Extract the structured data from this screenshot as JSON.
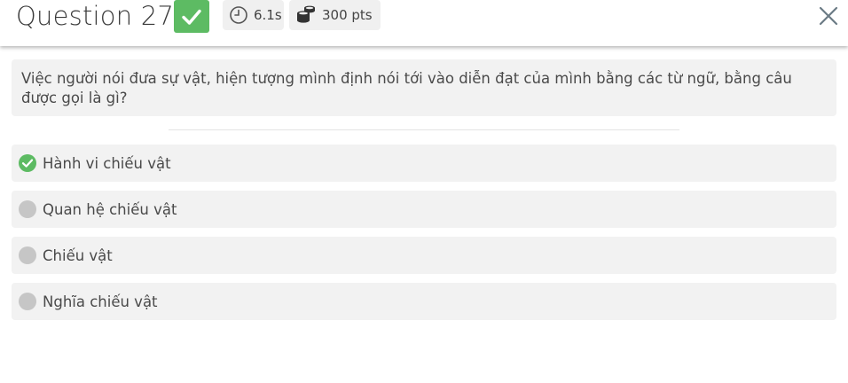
{
  "header": {
    "title": "Question 27",
    "status_icon": "check-icon",
    "time": "6.1s",
    "points": "300 pts",
    "close_icon": "close-icon"
  },
  "question": {
    "text": "Việc người nói đưa sự vật, hiện tượng mình định nói tới vào diễn đạt của mình bằng các từ ngữ, bằng câu được gọi là gì?"
  },
  "options": [
    {
      "label": "Hành vi chiếu vật",
      "state": "correct"
    },
    {
      "label": "Quan hệ chiếu vật",
      "state": "unselected"
    },
    {
      "label": "Chiếu vật",
      "state": "unselected"
    },
    {
      "label": "Nghĩa chiếu vật",
      "state": "unselected"
    }
  ],
  "colors": {
    "correct": "#5dbb63",
    "neutral": "#c6c6c6",
    "panel": "#f2f2f2"
  }
}
